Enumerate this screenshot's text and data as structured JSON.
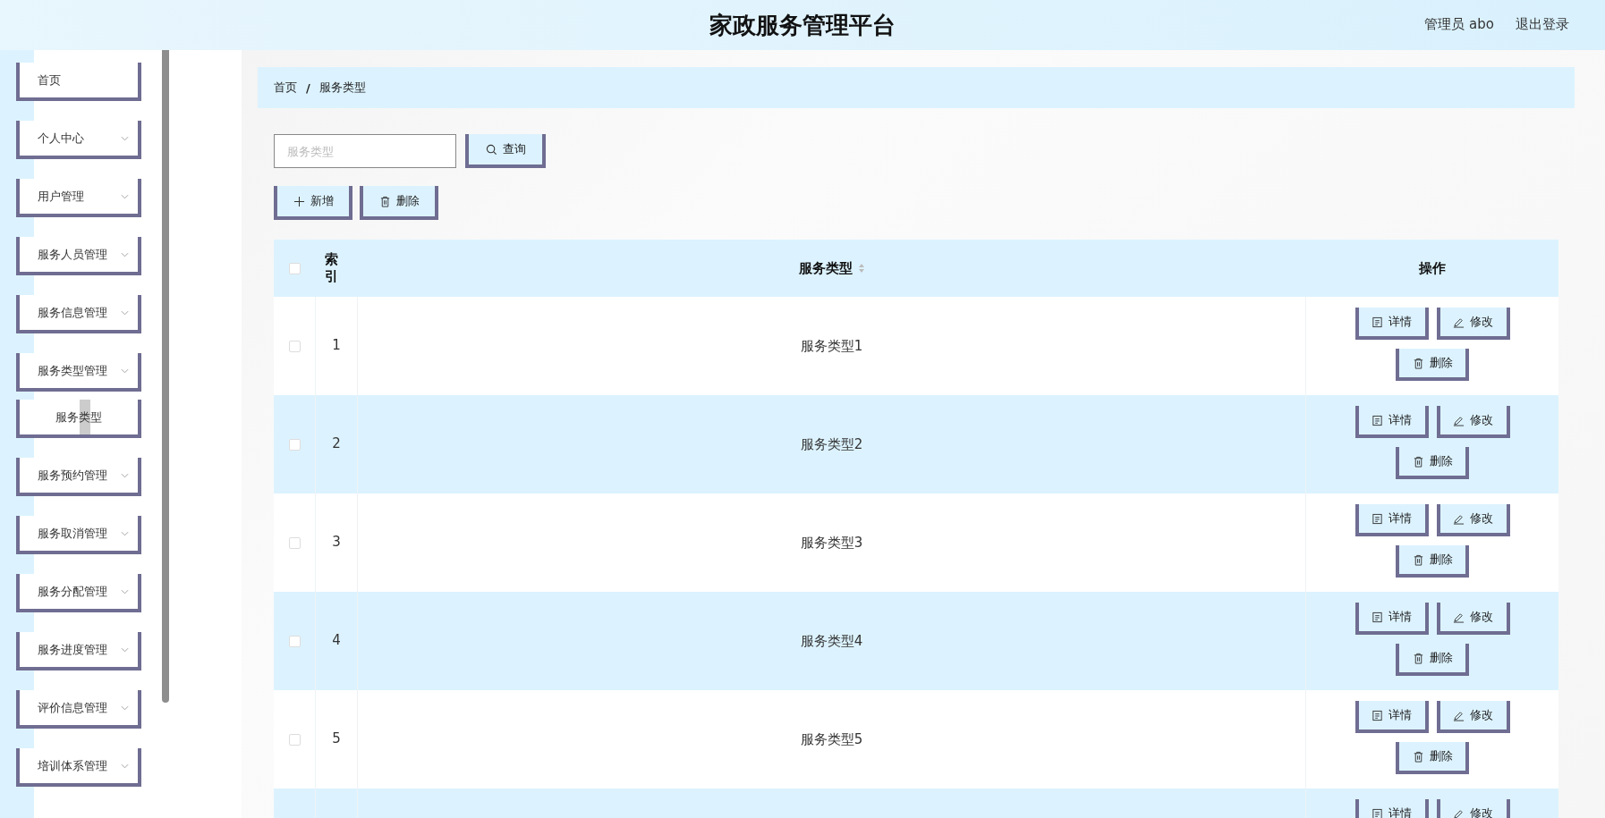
{
  "header": {
    "title": "家政服务管理平台",
    "user": "管理员 abo",
    "logout": "退出登录"
  },
  "sidebar": {
    "items": [
      {
        "label": "首页",
        "expandable": false
      },
      {
        "label": "个人中心",
        "expandable": true
      },
      {
        "label": "用户管理",
        "expandable": true
      },
      {
        "label": "服务人员管理",
        "expandable": true
      },
      {
        "label": "服务信息管理",
        "expandable": true
      },
      {
        "label": "服务类型管理",
        "expandable": true,
        "children": [
          {
            "label": "服务类型",
            "selected": true
          }
        ]
      },
      {
        "label": "服务预约管理",
        "expandable": true
      },
      {
        "label": "服务取消管理",
        "expandable": true
      },
      {
        "label": "服务分配管理",
        "expandable": true
      },
      {
        "label": "服务进度管理",
        "expandable": true
      },
      {
        "label": "评价信息管理",
        "expandable": true
      },
      {
        "label": "培训体系管理",
        "expandable": true
      }
    ]
  },
  "breadcrumb": {
    "items": [
      "首页",
      "服务类型"
    ],
    "separator": "/"
  },
  "search": {
    "placeholder": "服务类型",
    "button": "查询"
  },
  "toolbar": [
    {
      "kind": "add",
      "label": "新增"
    },
    {
      "kind": "delete",
      "label": "删除"
    }
  ],
  "table": {
    "all_checked": false,
    "columns": {
      "index": "索引",
      "type": "服务类型",
      "actions": "操作"
    },
    "sortable": true,
    "rows": [
      {
        "index": "1",
        "type": "服务类型1",
        "checked": false,
        "actions": [
          {
            "kind": "detail",
            "label": "详情"
          },
          {
            "kind": "edit",
            "label": "修改"
          },
          {
            "kind": "delete",
            "label": "删除"
          }
        ]
      },
      {
        "index": "2",
        "type": "服务类型2",
        "checked": false,
        "actions": [
          {
            "kind": "detail",
            "label": "详情"
          },
          {
            "kind": "edit",
            "label": "修改"
          },
          {
            "kind": "delete",
            "label": "删除"
          }
        ]
      },
      {
        "index": "3",
        "type": "服务类型3",
        "checked": false,
        "actions": [
          {
            "kind": "detail",
            "label": "详情"
          },
          {
            "kind": "edit",
            "label": "修改"
          },
          {
            "kind": "delete",
            "label": "删除"
          }
        ]
      },
      {
        "index": "4",
        "type": "服务类型4",
        "checked": false,
        "actions": [
          {
            "kind": "detail",
            "label": "详情"
          },
          {
            "kind": "edit",
            "label": "修改"
          },
          {
            "kind": "delete",
            "label": "删除"
          }
        ]
      },
      {
        "index": "5",
        "type": "服务类型5",
        "checked": false,
        "actions": [
          {
            "kind": "detail",
            "label": "详情"
          },
          {
            "kind": "edit",
            "label": "修改"
          },
          {
            "kind": "delete",
            "label": "删除"
          }
        ]
      },
      {
        "actions": [
          {
            "kind": "detail",
            "label": "详情"
          },
          {
            "kind": "edit",
            "label": "修改"
          }
        ]
      }
    ]
  }
}
